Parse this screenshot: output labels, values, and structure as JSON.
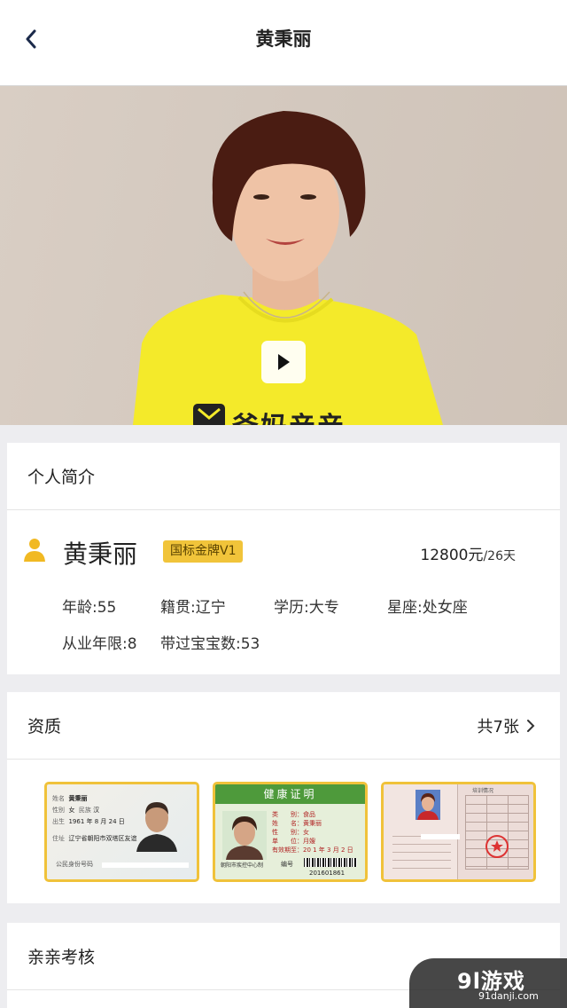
{
  "nav": {
    "title": "黄秉丽",
    "back_icon": "chevron-left-icon"
  },
  "video": {
    "shirt_text": "爸妈亲亲",
    "play_icon": "play-icon"
  },
  "intro": {
    "header": "个人简介",
    "name": "黄秉丽",
    "badge": "国标金牌V1",
    "price_amount": "12800元",
    "price_unit": "/26天",
    "fields": {
      "age": "年龄:55",
      "hometown": "籍贯:辽宁",
      "education": "学历:大专",
      "zodiac": "星座:处女座",
      "years": "从业年限:8",
      "babies": "带过宝宝数:53"
    }
  },
  "qualification": {
    "header": "资质",
    "count": "共7张",
    "id_card": {
      "name_label": "姓名",
      "name": "黄秉丽",
      "sex_label": "性别",
      "sex": "女",
      "ethnic_label": "民族",
      "ethnic": "汉",
      "birth_label": "出生",
      "birth": "1961 年 8 月 24 日",
      "addr_label": "住址",
      "addr": "辽宁省朝阳市双塔区友谊",
      "id_label": "公民身份号码"
    },
    "health": {
      "title": "健康证明",
      "rows": [
        "类　　别：食品",
        "姓　　名：黄秉丽",
        "性　　别：女",
        "单　　位：月嫂",
        "有效期至：20 1 年 3 月 2 日"
      ],
      "issuer": "朝阳市疾控中心制",
      "number_label": "编号",
      "number": "201601861"
    },
    "book": {
      "header": "培训情况"
    }
  },
  "review": {
    "header": "亲亲考核"
  },
  "watermark": {
    "logo": "9l游戏",
    "site": "91danji.com"
  },
  "colors": {
    "accent": "#f1c43a",
    "background": "#ededf0"
  }
}
